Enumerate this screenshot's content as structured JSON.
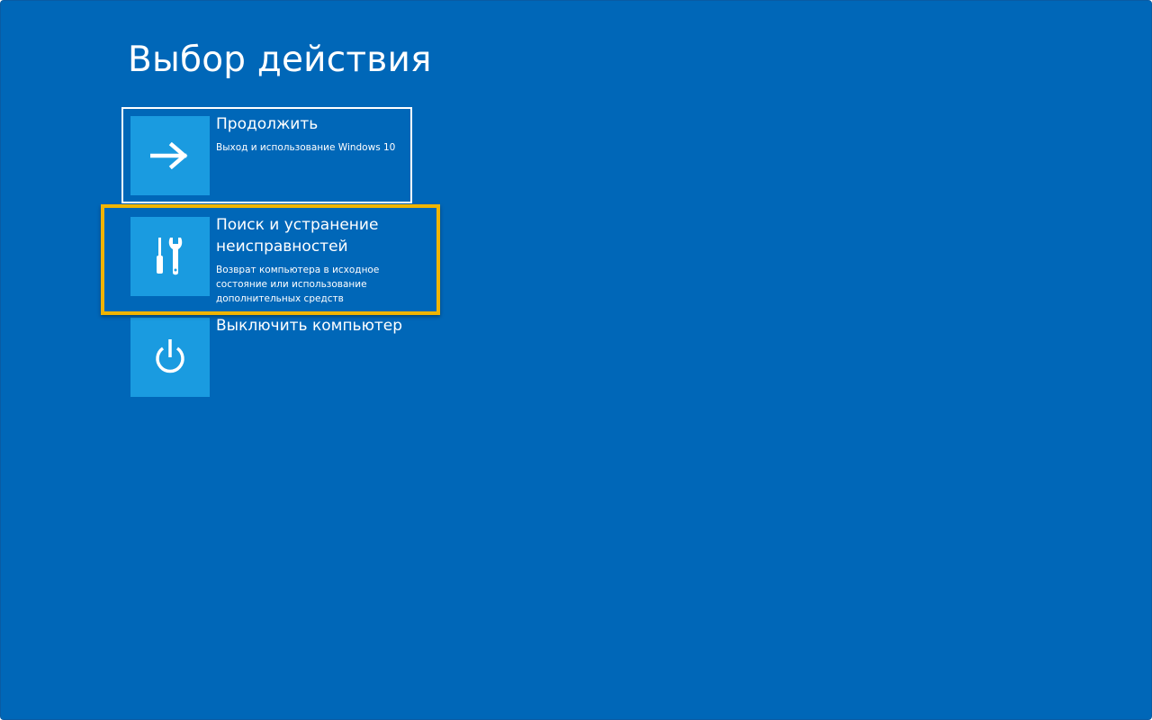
{
  "page": {
    "title": "Выбор действия"
  },
  "options": [
    {
      "label": "Продолжить",
      "description": "Выход и использование Windows 10",
      "icon": "arrow-right-icon"
    },
    {
      "label": "Поиск и устранение неисправностей",
      "description": "Возврат компьютера в исходное состояние или использование дополнительных средств",
      "icon": "tools-icon"
    },
    {
      "label": "Выключить компьютер",
      "description": "",
      "icon": "power-icon"
    }
  ],
  "colors": {
    "background": "#0067b8",
    "tile": "#1a9be0",
    "text": "#ffffff",
    "highlight": "#f0b400"
  }
}
